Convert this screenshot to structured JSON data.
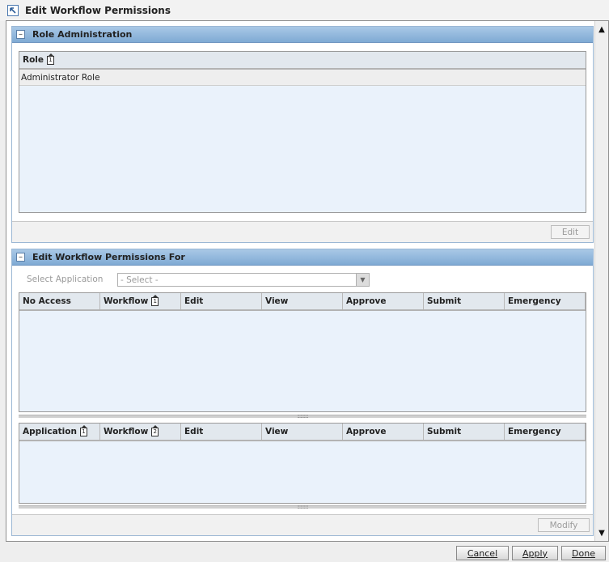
{
  "window": {
    "title": "Edit Workflow Permissions"
  },
  "role_admin": {
    "title": "Role Administration",
    "columns": [
      {
        "label": "Role",
        "sort": "1"
      }
    ],
    "rows": [
      "Administrator Role"
    ],
    "edit_button": "Edit"
  },
  "permissions": {
    "title": "Edit Workflow Permissions For",
    "select_label": "Select Application",
    "select_value": "- Select -",
    "upper_columns": [
      {
        "label": "No Access",
        "sort": ""
      },
      {
        "label": "Workflow",
        "sort": "1"
      },
      {
        "label": "Edit",
        "sort": ""
      },
      {
        "label": "View",
        "sort": ""
      },
      {
        "label": "Approve",
        "sort": ""
      },
      {
        "label": "Submit",
        "sort": ""
      },
      {
        "label": "Emergency",
        "sort": ""
      }
    ],
    "lower_columns": [
      {
        "label": "Application",
        "sort": "1"
      },
      {
        "label": "Workflow",
        "sort": "2"
      },
      {
        "label": "Edit",
        "sort": ""
      },
      {
        "label": "View",
        "sort": ""
      },
      {
        "label": "Approve",
        "sort": ""
      },
      {
        "label": "Submit",
        "sort": ""
      },
      {
        "label": "Emergency",
        "sort": ""
      }
    ],
    "modify_button": "Modify"
  },
  "footer": {
    "cancel": "Cancel",
    "apply": "Apply",
    "done": "Done"
  }
}
